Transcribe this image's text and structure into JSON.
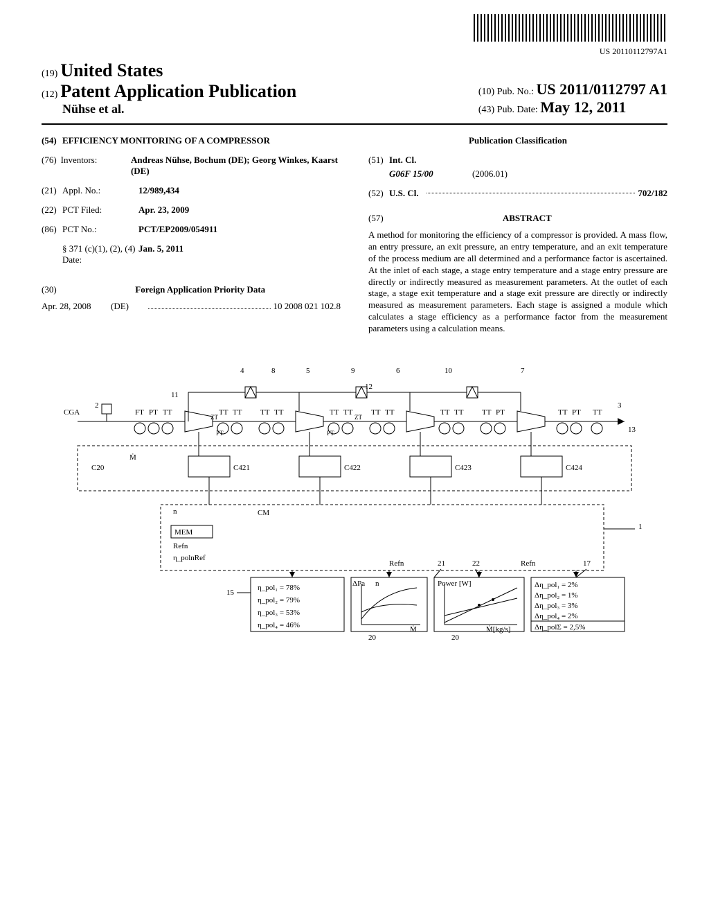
{
  "barcode_label": "US 20110112797A1",
  "header": {
    "line19": "(19)",
    "us": "United States",
    "line12": "(12)",
    "pap": "Patent Application Publication",
    "authors": "Nühse et al.",
    "line10": "(10)",
    "pubno_label": "Pub. No.:",
    "pubno": "US 2011/0112797 A1",
    "line43": "(43)",
    "pubdate_label": "Pub. Date:",
    "pubdate": "May 12, 2011"
  },
  "left": {
    "n54": "(54)",
    "title": "EFFICIENCY MONITORING OF A COMPRESSOR",
    "n76": "(76)",
    "inventors_label": "Inventors:",
    "inventors": "Andreas Nühse, Bochum (DE); Georg Winkes, Kaarst (DE)",
    "n21": "(21)",
    "appl_label": "Appl. No.:",
    "appl_no": "12/989,434",
    "n22": "(22)",
    "pct_filed_label": "PCT Filed:",
    "pct_filed": "Apr. 23, 2009",
    "n86": "(86)",
    "pct_no_label": "PCT No.:",
    "pct_no": "PCT/EP2009/054911",
    "s371_label": "§ 371 (c)(1), (2), (4) Date:",
    "s371_date": "Jan. 5, 2011",
    "n30": "(30)",
    "foreign_head": "Foreign Application Priority Data",
    "foreign_date": "Apr. 28, 2008",
    "foreign_country": "(DE)",
    "foreign_no": "10 2008 021 102.8"
  },
  "right": {
    "classif_head": "Publication Classification",
    "n51": "(51)",
    "intcl_label": "Int. Cl.",
    "intcl_code": "G06F 15/00",
    "intcl_year": "(2006.01)",
    "n52": "(52)",
    "uscl_label": "U.S. Cl.",
    "uscl_code": "702/182",
    "n57": "(57)",
    "abstract_head": "ABSTRACT",
    "abstract_text": "A method for monitoring the efficiency of a compressor is provided. A mass flow, an entry pressure, an exit pressure, an entry temperature, and an exit temperature of the process medium are all determined and a performance factor is ascertained. At the inlet of each stage, a stage entry temperature and a stage entry pressure are directly or indirectly measured as measurement parameters. At the outlet of each stage, a stage exit temperature and a stage exit pressure are directly or indirectly measured as measurement parameters. Each stage is assigned a module which calculates a stage efficiency as a performance factor from the measurement parameters using a calculation means."
  },
  "figure": {
    "labels": [
      "CGA",
      "2",
      "4",
      "8",
      "5",
      "9",
      "6",
      "10",
      "7",
      "11",
      "12",
      "3",
      "13",
      "1",
      "C20",
      "C421",
      "C422",
      "C423",
      "C424",
      "CM",
      "MEM",
      "Refn",
      "15",
      "17",
      "20",
      "21",
      "22"
    ],
    "eff_values": [
      "η_pol₁ = 78%",
      "η_pol₂ = 79%",
      "η_pol₃ = 53%",
      "η_pol₄ = 46%"
    ],
    "delta_values": [
      "Δη_pol₁ = 2%",
      "Δη_pol₂ = 1%",
      "Δη_pol₃ = 3%",
      "Δη_pol₄ = 2%",
      "Δη_polΣ = 2,5%"
    ],
    "sensors": [
      "FT",
      "PT",
      "TT",
      "ZT"
    ],
    "axis_labels": [
      "ΔPa",
      "n",
      "Ṁ",
      "Power [W]",
      "Ṁ[kg/s]"
    ],
    "cm_box": [
      "n",
      "MEM",
      "Refn",
      "η_polnRef"
    ]
  }
}
